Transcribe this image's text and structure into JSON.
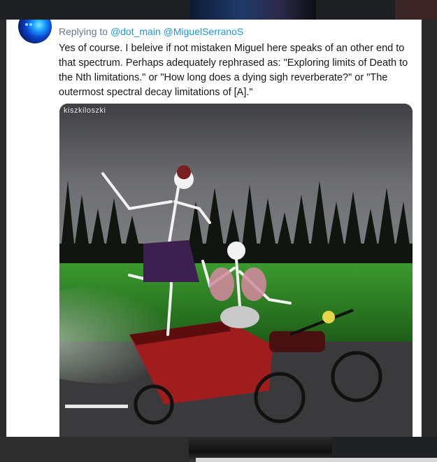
{
  "tweet": {
    "replying_prefix": "Replying to",
    "mentions": [
      "@dot_main",
      "@MiguelSerranoS"
    ],
    "text": "Yes of course. I beleive if not mistaken Miguel here speaks of an other end to that spectrum. Perhaps adequately rephrased as: \"Exploring limits of Death to the Nth limitations.\" or \"How long does a dying sigh reverberate?\" or \"The outermost spectral decay limitations of [A].\""
  },
  "media": {
    "watermark": "kiszkiloszki",
    "description_icon": "dancing-skeletons-image"
  },
  "colors": {
    "mention": "#1b95e0",
    "muted": "#657786",
    "text": "#14171a"
  }
}
